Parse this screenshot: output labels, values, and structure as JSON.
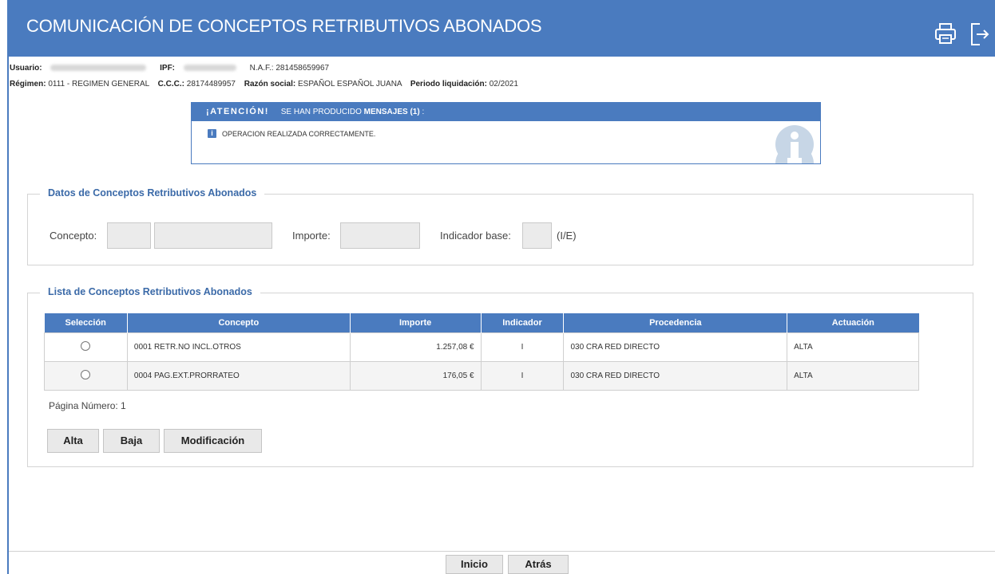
{
  "header": {
    "title": "COMUNICACIÓN DE CONCEPTOS RETRIBUTIVOS ABONADOS",
    "print_icon": "printer-icon",
    "exit_icon": "logout-icon"
  },
  "info": {
    "usuario_label": "Usuario:",
    "ipf_label": "IPF:",
    "naf_label": "N.A.F.:",
    "naf_value": "281458659967",
    "regimen_label": "Régimen:",
    "regimen_value": "0111 - REGIMEN GENERAL",
    "ccc_label": "C.C.C.:",
    "ccc_value": "28174489957",
    "razon_label": "Razón social:",
    "razon_value": "ESPAÑOL ESPAÑOL JUANA",
    "periodo_label": "Periodo liquidación:",
    "periodo_value": "02/2021"
  },
  "alert": {
    "attention": "¡ATENCIÓN!",
    "produced": "SE HAN PRODUCIDO",
    "messages": "MENSAJES (1)",
    "colon": ":",
    "message": "OPERACION REALIZADA CORRECTAMENTE."
  },
  "datos": {
    "legend": "Datos de Conceptos Retributivos Abonados",
    "concepto_label": "Concepto:",
    "importe_label": "Importe:",
    "indicador_label": "Indicador base:",
    "indicador_hint": "(I/E)"
  },
  "lista": {
    "legend": "Lista de Conceptos Retributivos Abonados",
    "columns": [
      "Selección",
      "Concepto",
      "Importe",
      "Indicador",
      "Procedencia",
      "Actuación"
    ],
    "rows": [
      {
        "concepto": "0001 RETR.NO INCL.OTROS",
        "importe": "1.257,08 €",
        "indicador": "I",
        "procedencia": "030 CRA RED DIRECTO",
        "actuacion": "ALTA"
      },
      {
        "concepto": "0004 PAG.EXT.PRORRATEO",
        "importe": "176,05 €",
        "indicador": "I",
        "procedencia": "030 CRA RED DIRECTO",
        "actuacion": "ALTA"
      }
    ],
    "page_number": "Página Número: 1",
    "buttons": {
      "alta": "Alta",
      "baja": "Baja",
      "modificacion": "Modificación"
    }
  },
  "footer": {
    "inicio": "Inicio",
    "atras": "Atrás"
  },
  "colors": {
    "brand": "#4a7bbf"
  }
}
